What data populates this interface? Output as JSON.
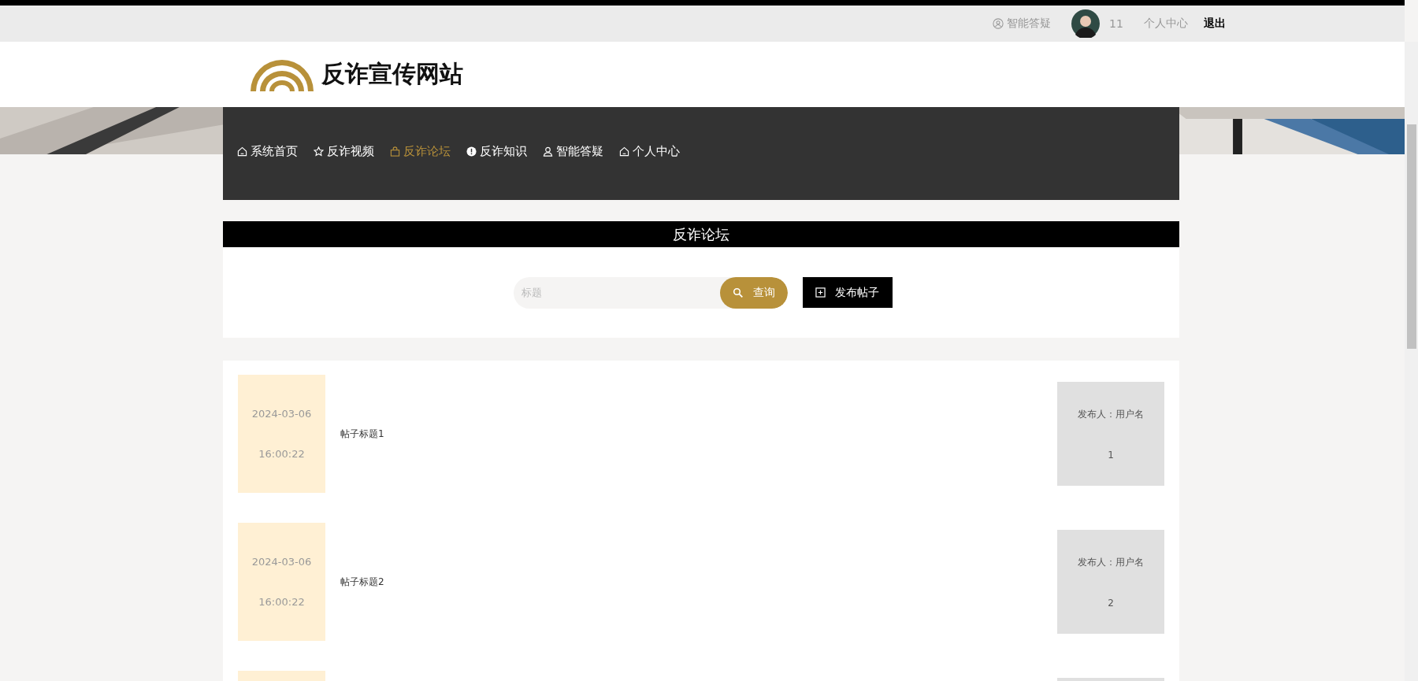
{
  "top_bar": {
    "links": [
      {
        "kind": "qa",
        "label": "智能答疑"
      },
      {
        "kind": "user",
        "label": "11"
      },
      {
        "kind": "link",
        "label": "个人中心"
      },
      {
        "kind": "logout",
        "label": "退出"
      }
    ]
  },
  "header": {
    "site_name": "反诈宣传网站"
  },
  "nav": {
    "items": [
      {
        "kind": "home",
        "label": "系统首页",
        "selected": false
      },
      {
        "kind": "star",
        "label": "反诈视频",
        "selected": false
      },
      {
        "kind": "bag",
        "label": "反诈论坛",
        "selected": true
      },
      {
        "kind": "alert",
        "label": "反诈知识",
        "selected": false
      },
      {
        "kind": "person",
        "label": "智能答疑",
        "selected": false
      },
      {
        "kind": "home",
        "label": "个人中心",
        "selected": false
      }
    ]
  },
  "section": {
    "title": "反诈论坛"
  },
  "search": {
    "placeholder": "标题",
    "button": "查询",
    "post_button": "发布帖子"
  },
  "posts": [
    {
      "date": "2024-03-06",
      "time": "16:00:22",
      "title": "帖子标题1",
      "author": "发布人：用户名",
      "count": "1"
    },
    {
      "date": "2024-03-06",
      "time": "16:00:22",
      "title": "帖子标题2",
      "author": "发布人：用户名",
      "count": "2"
    }
  ]
}
